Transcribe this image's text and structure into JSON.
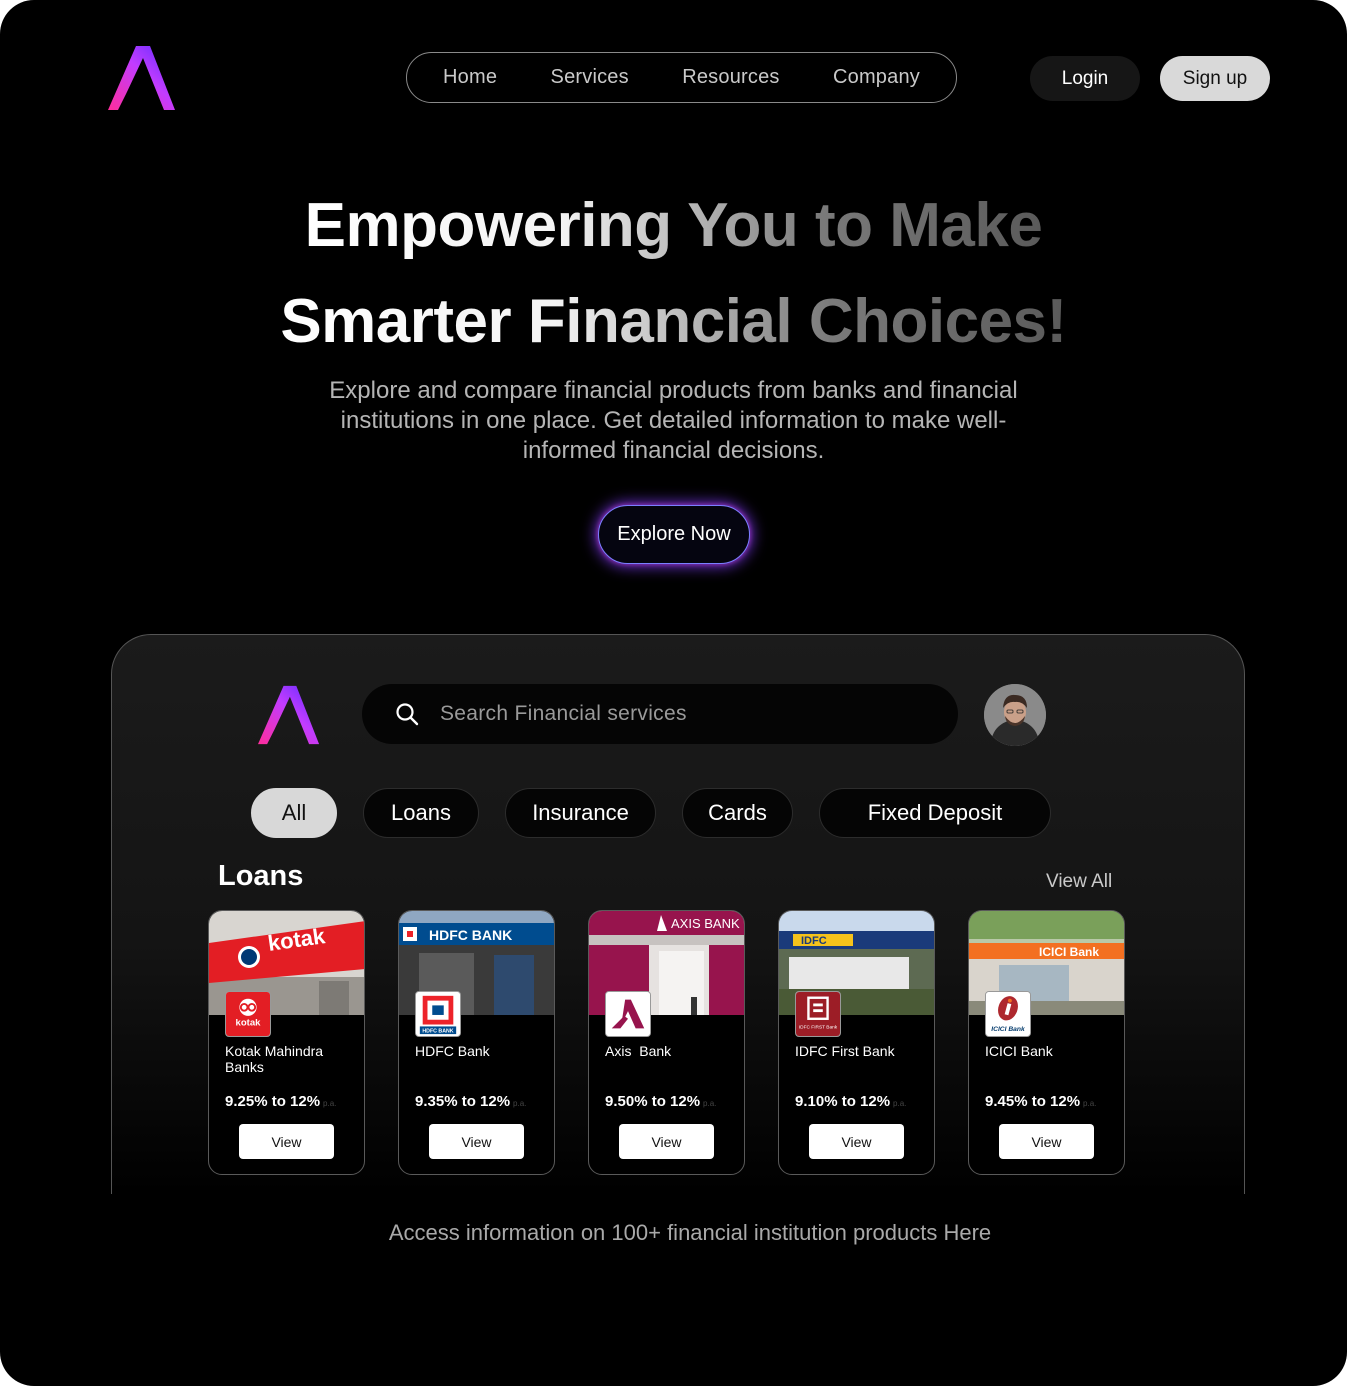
{
  "nav": {
    "links": [
      "Home",
      "Services",
      "Resources",
      "Company"
    ],
    "login": "Login",
    "signup": "Sign up"
  },
  "hero": {
    "line1": "Empowering You to Make",
    "line2": "Smarter Financial Choices!",
    "subtitle": "Explore and compare financial products from banks and financial institutions in one place. Get detailed information to make well-informed financial decisions.",
    "cta": "Explore Now"
  },
  "app": {
    "search_placeholder": "Search Financial services",
    "chips": [
      "All",
      "Loans",
      "Insurance",
      "Cards",
      "Fixed Deposit"
    ],
    "active_chip": "All",
    "section_title": "Loans",
    "view_all": "View All",
    "cards": [
      {
        "name": "Kotak Mahindra Banks",
        "rate": "9.25% to 12%",
        "suffix": "p.a.",
        "button": "View",
        "photo_sign": "kotak",
        "badge_text": "kotak"
      },
      {
        "name": "HDFC Bank",
        "rate": "9.35% to 12%",
        "suffix": "p.a.",
        "button": "View",
        "photo_sign": "HDFC BANK",
        "badge_text": "HDFC BANK"
      },
      {
        "name": "Axis  Bank",
        "rate": "9.50% to 12%",
        "suffix": "p.a.",
        "button": "View",
        "photo_sign": "AXIS BANK",
        "badge_text": ""
      },
      {
        "name": "IDFC First Bank",
        "rate": "9.10% to 12%",
        "suffix": "p.a.",
        "button": "View",
        "photo_sign": "IDFC",
        "badge_text": "IDFC FIRST Bank"
      },
      {
        "name": "ICICI Bank",
        "rate": "9.45% to 12%",
        "suffix": "p.a.",
        "button": "View",
        "photo_sign": "ICICI Bank",
        "badge_text": "ICICI Bank"
      }
    ]
  },
  "footer": {
    "text": "Access information on 100+ financial institution products Here"
  },
  "colors": {
    "background": "#000000",
    "logo_gradient_start": "#ff2d9b",
    "logo_gradient_end": "#5b2bff",
    "cta_glow": "#823cff",
    "kotak_red": "#e31e24",
    "hdfc_blue": "#004c8f",
    "axis_maroon": "#97144d",
    "idfc_red": "#9c1d26",
    "icici_orange": "#f37021"
  },
  "icons": [
    "brand-logo-icon",
    "search-icon",
    "user-avatar"
  ]
}
